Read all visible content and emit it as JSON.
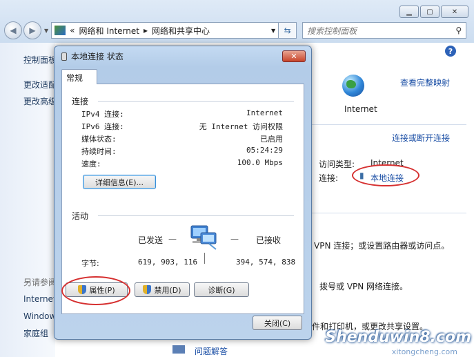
{
  "explorer": {
    "address": {
      "chevrons": "«",
      "crumbs": [
        "网络和 Internet",
        "网络和共享中心"
      ],
      "separator": "▸"
    },
    "search_placeholder": "搜索控制面板",
    "left_pane": {
      "items": [
        "控制面板主页",
        "更改适配器设置",
        "更改高级共享设置"
      ],
      "see_also_heading": "另请参阅",
      "see_also": [
        "Internet 选项",
        "Windows 防火墙",
        "家庭组"
      ]
    },
    "right": {
      "view_full_map": "查看完整映射",
      "internet_label": "Internet",
      "connect_disconnect": "连接或断开连接",
      "access_type_label": "访问类型:",
      "access_type_value": "Internet",
      "connection_label": "连接:",
      "connection_value": "本地连接",
      "text_vpn": "VPN 连接；或设置路由器或访问点。",
      "text_dial": "拨号或 VPN 网络连接。",
      "text_printer": "件和打印机，或更改共享设置。",
      "text_troubleshoot": "问题解答"
    },
    "watermark": "Shenduwin8.com",
    "watermark_sub": "xitongcheng.com"
  },
  "dialog": {
    "title": "本地连接 状态",
    "close_glyph": "✕",
    "tab": "常规",
    "connection_group": "连接",
    "rows": [
      {
        "label": "IPv4 连接:",
        "value": "Internet"
      },
      {
        "label": "IPv6 连接:",
        "value": "无 Internet 访问权限"
      },
      {
        "label": "媒体状态:",
        "value": "已启用"
      },
      {
        "label": "持续时间:",
        "value": "05:24:29"
      },
      {
        "label": "速度:",
        "value": "100.0 Mbps"
      }
    ],
    "details_button": "详细信息(E)...",
    "activity_group": "活动",
    "sent_label": "已发送",
    "received_label": "已接收",
    "bytes_label": "字节:",
    "bytes_sent": "619, 903, 116",
    "bytes_received": "394, 574, 838",
    "properties_button": "属性(P)",
    "disable_button": "禁用(D)",
    "diagnose_button": "诊断(G)",
    "close_button": "关闭(C)"
  }
}
